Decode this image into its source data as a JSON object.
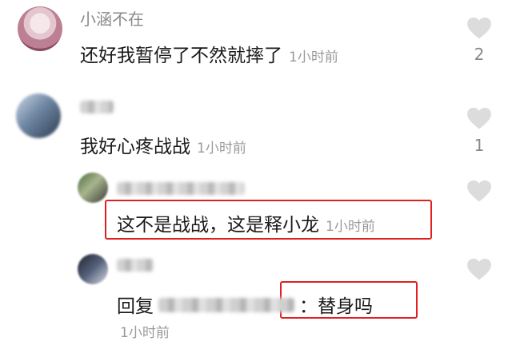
{
  "comments": [
    {
      "username": "小涵不在",
      "text": "还好我暂停了不然就摔了",
      "time": "1小时前",
      "likes": "2"
    },
    {
      "username": "",
      "text": "我好心疼战战",
      "time": "1小时前",
      "likes": "1"
    }
  ],
  "replies": [
    {
      "username": "",
      "text": "这不是战战，这是释小龙",
      "time": "1小时前"
    },
    {
      "username": "",
      "reply_prefix": "回复",
      "reply_suffix": "：替身吗",
      "time": "1小时前"
    }
  ],
  "colors": {
    "highlight_box": "#e02020",
    "heart": "#dcdcdc"
  }
}
